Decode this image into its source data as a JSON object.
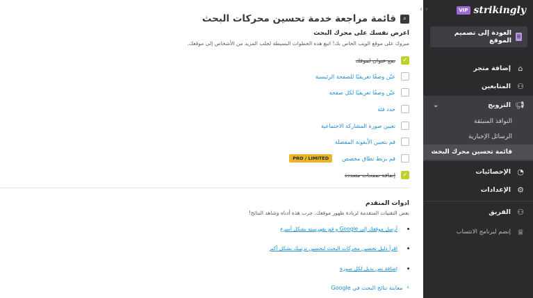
{
  "sidebar": {
    "logo": "strikingly",
    "vip_badge": "VIP",
    "back_button": "العودة إلى تصميم الموقع",
    "items": {
      "add_store": "إضافة متجر",
      "followers": "المتابعين",
      "promotion": "الترويج",
      "popups": "النوافذ المنبثقة",
      "newsletters": "الرسائل الإخبارية",
      "seo_checklist": "قائمة تحسين محرك البحث",
      "analytics": "الإحصائيات",
      "settings": "الإعدادات",
      "team": "الفريق",
      "affiliate": "إنضم لبرنامج الانتساب"
    }
  },
  "main": {
    "title": "قائمة مراجعة خدمة تحسين محركات البحث",
    "section1": {
      "title": "اعرض نفسك على محرك البحث",
      "description": "مبروك على موقع الويب الخاص بك! اتبع هذه الخطوات البسيطة لجلب المزيد من الأشخاص إلى موقعك.",
      "tasks": [
        {
          "label": "ضع عنوان لموقك",
          "done": true
        },
        {
          "label": "عيّن وصفًا تعريفيًا للصفحة الرئيسية",
          "done": false
        },
        {
          "label": "عيّن وصفًا تعريفيًا لكل صفحة",
          "done": false
        },
        {
          "label": "حدد فئة",
          "done": false
        },
        {
          "label": "تعيين صورة المشاركة الاجتماعية",
          "done": false
        },
        {
          "label": "قم بتعيين الأيقونة المفضلة",
          "done": false
        },
        {
          "label": "قم بربط نطاق مخصص",
          "done": false,
          "badge": "PRO / LIMITED"
        },
        {
          "label": "إضافة صفحات متعددة",
          "done": true
        }
      ]
    },
    "section2": {
      "title": "ادوات المتقدم",
      "description": "بعض التقنيات المتقدمة لزيادة ظهور موقعك. جرب هذه أدناه وشاهد النتائج!",
      "links": [
        "أرسل موقعك إلى Google و قم بفهرسته بشكل أسرع",
        "اقرأ دليل تحسين محركات البحث لتحسين ترتيبك بشكل أكبر",
        "إضافة نص بديل لكل صورة"
      ]
    },
    "preview_link": "معاينة نتائج البحث في Google"
  },
  "colors": {
    "sidebar_bg": "#2b2b2d",
    "accent_link": "#1f8fd4",
    "check_done": "#bfcf2c",
    "badge": "#e9b52a",
    "vip": "#9a6bd6"
  }
}
